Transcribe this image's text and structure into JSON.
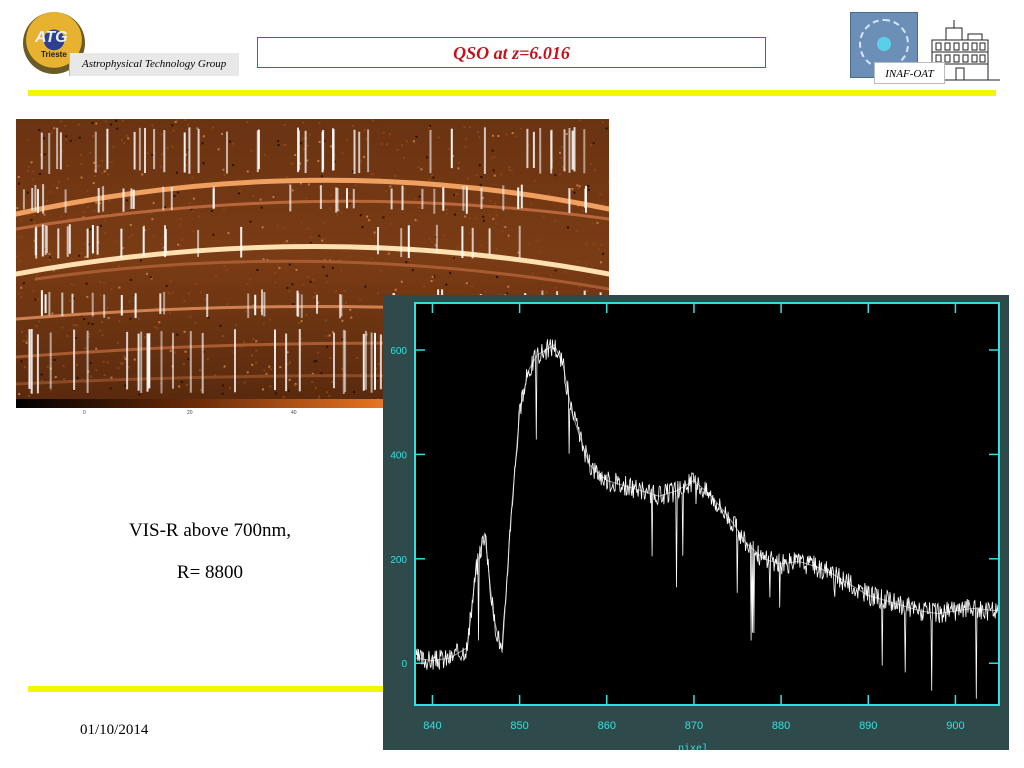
{
  "header": {
    "logo_left": {
      "text": "ATG",
      "subtext": "Trieste",
      "icon": "atg-logo-icon"
    },
    "group_name": "Astrophysical Technology Group",
    "title": "QSO at z=6.016",
    "logo_right": {
      "icon": "inaf-logo-icon"
    },
    "building_icon": "observatory-building-icon",
    "inaf_label": "INAF-OAT"
  },
  "colors": {
    "title_red": "#c0141c",
    "rule_yellow": "#f5f500",
    "plot_bg": "#2e4a4a",
    "plot_axis": "#33e0e0",
    "plot_trace": "#ffffff"
  },
  "echelle_image": {
    "colorbar_ticks": [
      "0",
      "20",
      "40"
    ]
  },
  "caption": {
    "line1": "VIS-R above 700nm,",
    "line2": "R= 8800"
  },
  "footer": {
    "date": "01/10/2014"
  },
  "chart_data": {
    "type": "line",
    "xlabel": "pixel",
    "ylabel": "",
    "xlim": [
      838,
      905
    ],
    "ylim": [
      -80,
      690
    ],
    "x_ticks": [
      840,
      850,
      860,
      870,
      880,
      890,
      900
    ],
    "y_ticks": [
      0,
      200,
      400,
      600
    ],
    "x_tick_labels": [
      "840",
      "850",
      "860",
      "870",
      "880",
      "890",
      "900"
    ],
    "y_tick_labels": [
      "0",
      "200",
      "400",
      "600"
    ],
    "series": [
      {
        "x": [
          838,
          840,
          842,
          844,
          845,
          846,
          847,
          848,
          849,
          850,
          851,
          852,
          853,
          854,
          855,
          856,
          857,
          858,
          860,
          862,
          864,
          866,
          868,
          870,
          872,
          874,
          876,
          878,
          880,
          882,
          884,
          886,
          888,
          890,
          892,
          894,
          896,
          898,
          900,
          902,
          905
        ],
        "y": [
          10,
          5,
          10,
          30,
          180,
          250,
          90,
          20,
          280,
          480,
          560,
          590,
          600,
          610,
          570,
          480,
          430,
          380,
          350,
          340,
          330,
          320,
          330,
          350,
          320,
          280,
          230,
          200,
          190,
          195,
          185,
          170,
          150,
          130,
          120,
          110,
          100,
          95,
          100,
          105,
          100
        ]
      }
    ]
  }
}
